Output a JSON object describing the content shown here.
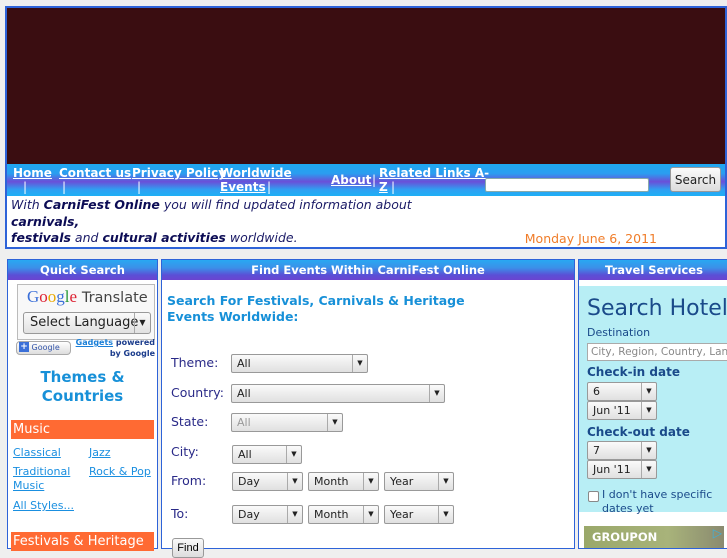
{
  "nav": {
    "links": [
      "Home",
      "Contact us",
      "Privacy Policy",
      "Worldwide",
      "Events",
      "About",
      "Related Links A-",
      "Z"
    ],
    "separator": "|",
    "search_value": "",
    "search_button": "Search"
  },
  "intro": {
    "with": "With",
    "brand": "CarniFest Online",
    "mid": "you will find updated information about",
    "carnivals": "carnivals,",
    "festivals": "festivals",
    "and": "and",
    "cultural": "cultural activities",
    "worldwide": "worldwide.",
    "date": "Monday June 6, 2011"
  },
  "left_panel": {
    "header": "Quick Search",
    "google_logo": "Google",
    "translate": "Translate",
    "select_language": "Select Language",
    "plus_google": "Google",
    "gadgets_link": "Gadgets",
    "gadgets_text1": "powered",
    "gadgets_text2": "by Google",
    "themes_title1": "Themes &",
    "themes_title2": "Countries",
    "music_header": "Music",
    "music_links": [
      "Classical",
      "Jazz",
      "Traditional",
      "Music",
      "Rock & Pop",
      "All Styles..."
    ],
    "festivals_header": "Festivals & Heritage"
  },
  "mid_panel": {
    "header": "Find Events Within CarniFest Online",
    "heading1": "Search For Festivals, Carnivals & Heritage",
    "heading2": "Events Worldwide:",
    "labels": {
      "theme": "Theme:",
      "country": "Country:",
      "state": "State:",
      "city": "City:",
      "from": "From:",
      "to": "To:"
    },
    "values": {
      "theme": "All",
      "country": "All",
      "state": "All",
      "city": "All"
    },
    "date_selects": {
      "day": "Day",
      "month": "Month",
      "year": "Year"
    },
    "find_button": "Find"
  },
  "right_panel": {
    "header": "Travel Services",
    "title": "Search Hotels",
    "destination_label": "Destination",
    "destination_placeholder": "City, Region, Country, Landmark",
    "checkin_label": "Check-in date",
    "checkin_day": "6",
    "checkin_month": "Jun '11",
    "checkout_label": "Check-out date",
    "checkout_day": "7",
    "checkout_month": "Jun '11",
    "no_dates_label": "I don't have specific dates yet",
    "ad_text": "GROUPON"
  }
}
